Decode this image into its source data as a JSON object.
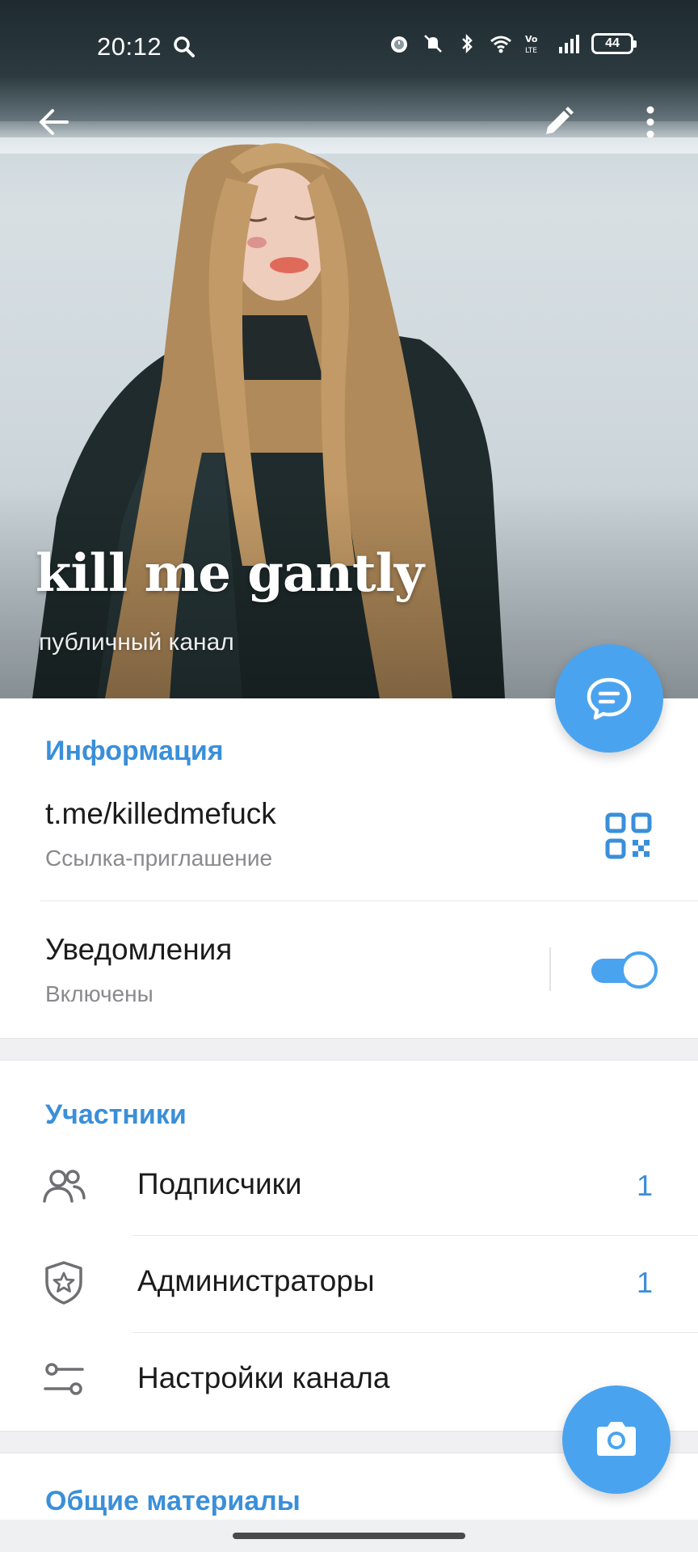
{
  "status_bar": {
    "time": "20:12",
    "battery": "44",
    "icons": [
      "search-icon",
      "alarm-icon",
      "mute-icon",
      "bluetooth-icon",
      "wifi-icon",
      "volte-icon",
      "signal-icon",
      "battery-icon"
    ]
  },
  "header": {
    "title": "kill me gantly",
    "subtitle": "публичный канал"
  },
  "info": {
    "header": "Информация",
    "link": "t.me/killedmefuck",
    "link_caption": "Ссылка-приглашение",
    "notifications_label": "Уведомления",
    "notifications_state": "Включены",
    "notifications_on": true
  },
  "members": {
    "header": "Участники",
    "items": [
      {
        "label": "Подписчики",
        "count": "1",
        "icon": "people-icon"
      },
      {
        "label": "Администраторы",
        "count": "1",
        "icon": "admin-shield-icon"
      },
      {
        "label": "Настройки канала",
        "count": "",
        "icon": "settings-sliders-icon"
      }
    ]
  },
  "shared": {
    "header": "Общие материалы"
  },
  "colors": {
    "accent": "#4aa3ef",
    "accent_text": "#3a8fd9",
    "secondary_text": "#8a8a8e"
  }
}
